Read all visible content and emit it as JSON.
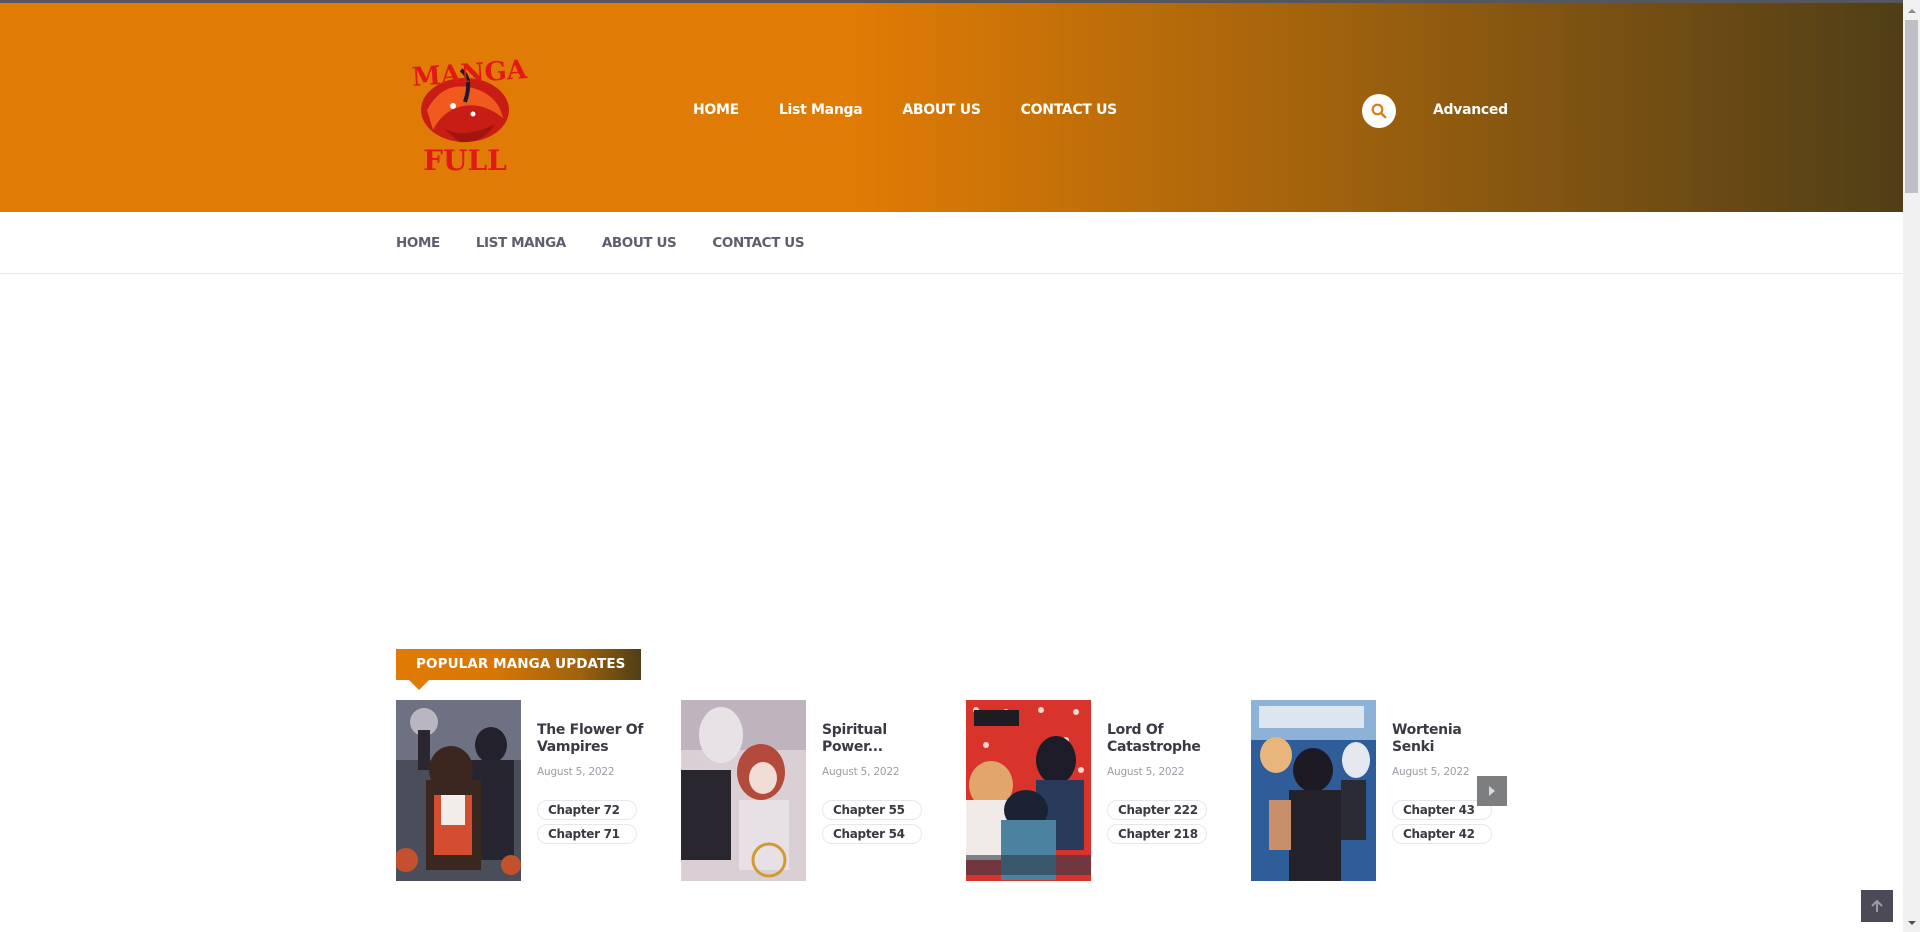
{
  "brand": {
    "logo_text_top": "MANGA",
    "logo_text_bottom": "FULL"
  },
  "header": {
    "nav": [
      {
        "label": "HOME"
      },
      {
        "label": "List Manga"
      },
      {
        "label": "ABOUT US"
      },
      {
        "label": "CONTACT US"
      }
    ],
    "search_icon": "search-icon",
    "advanced_label": "Advanced"
  },
  "sub_nav": [
    {
      "label": "HOME"
    },
    {
      "label": "LIST MANGA"
    },
    {
      "label": "ABOUT US"
    },
    {
      "label": "CONTACT US"
    }
  ],
  "popular": {
    "title": "POPULAR MANGA UPDATES",
    "items": [
      {
        "title": "The Flower Of Vampires",
        "date": "August 5, 2022",
        "chapters": [
          "Chapter 72",
          "Chapter 71"
        ]
      },
      {
        "title": "Spiritual Power...",
        "date": "August 5, 2022",
        "chapters": [
          "Chapter 55",
          "Chapter 54"
        ]
      },
      {
        "title": "Lord Of Catastrophe",
        "date": "August 5, 2022",
        "chapters": [
          "Chapter 222",
          "Chapter 218"
        ]
      },
      {
        "title": "Wortenia Senki",
        "date": "August 5, 2022",
        "chapters": [
          "Chapter 43",
          "Chapter 42"
        ]
      }
    ],
    "next_icon": "chevron-right-icon"
  },
  "back_to_top_icon": "arrow-up-icon",
  "colors": {
    "accent": "#e07b05",
    "accent_dark": "#4f3e17",
    "nav_text": "#5f5d6e",
    "title_text": "#3b3a44",
    "date_text": "#9e9aa7"
  }
}
